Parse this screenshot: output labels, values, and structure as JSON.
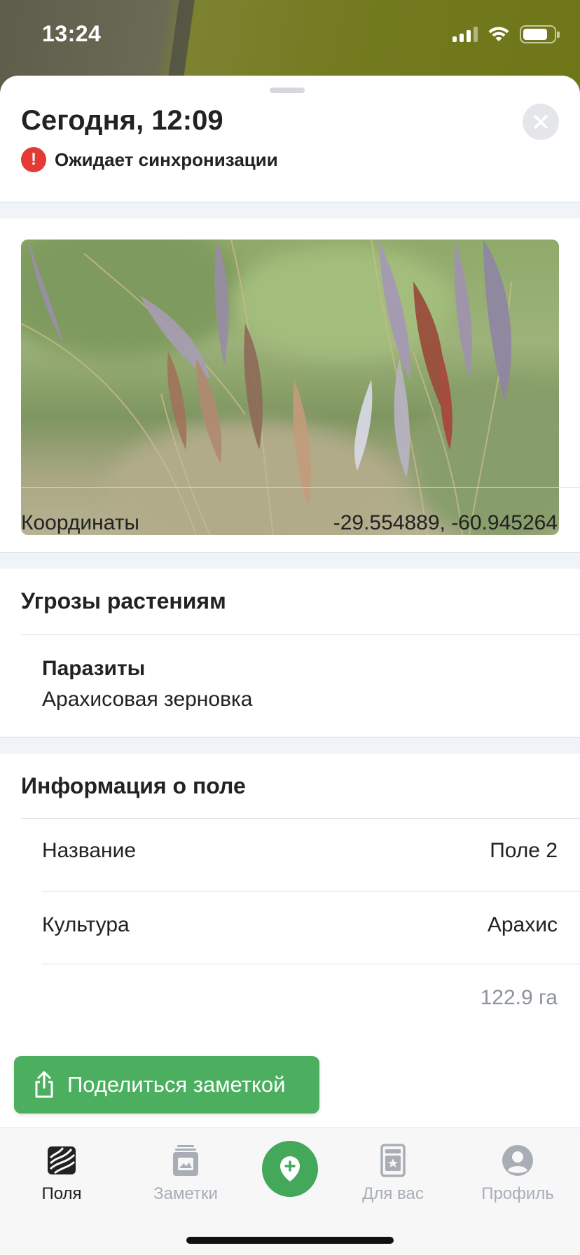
{
  "status_bar": {
    "time": "13:24"
  },
  "sheet": {
    "title": "Сегодня, 12:09",
    "sync_status": "Ожидает синхронизации"
  },
  "coordinates": {
    "label": "Координаты",
    "value": "-29.554889, -60.945264"
  },
  "threats": {
    "title": "Угрозы растениям",
    "items": [
      {
        "category": "Паразиты",
        "name": "Арахисовая зерновка"
      }
    ]
  },
  "field_info": {
    "title": "Информация о поле",
    "rows": [
      {
        "label": "Название",
        "value": "Поле 2"
      },
      {
        "label": "Культура",
        "value": "Арахис"
      },
      {
        "label": "",
        "value": "122.9 га"
      }
    ]
  },
  "share_button": {
    "label": "Поделиться заметкой"
  },
  "tabbar": {
    "tabs": [
      {
        "label": "Поля",
        "active": true
      },
      {
        "label": "Заметки",
        "active": false
      },
      {
        "label": "Для вас",
        "active": false
      },
      {
        "label": "Профиль",
        "active": false
      }
    ]
  },
  "colors": {
    "accent_green": "#4caf60",
    "alert_red": "#e53935"
  }
}
